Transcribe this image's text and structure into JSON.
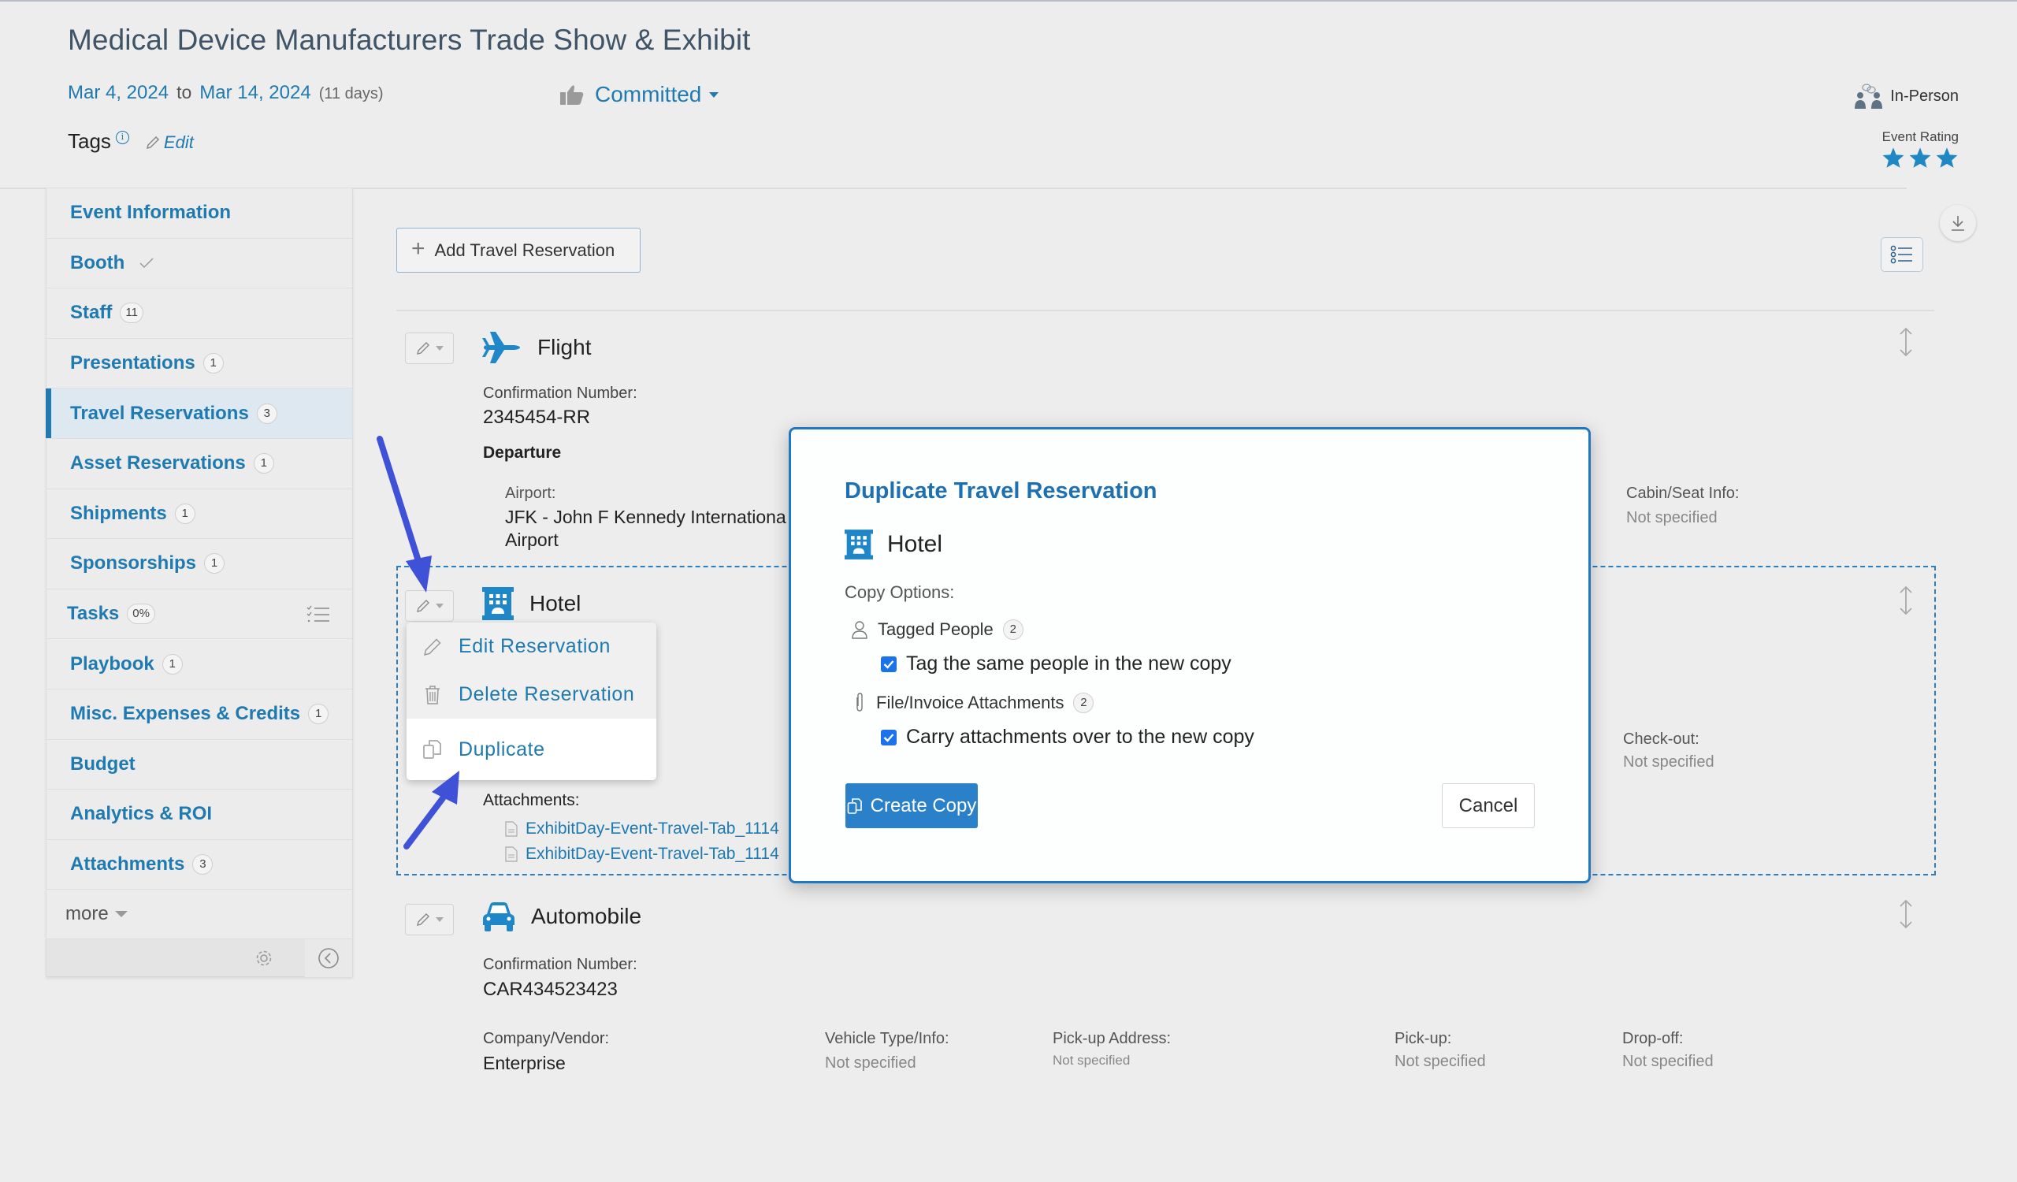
{
  "header": {
    "title": "Medical Device Manufacturers Trade Show & Exhibit",
    "start_date": "Mar 4, 2024",
    "to_label": "to",
    "end_date": "Mar 14, 2024",
    "duration": "(11 days)",
    "status": "Committed",
    "tags_label": "Tags",
    "tags_info_glyph": "i",
    "tags_edit": "Edit",
    "event_format": "In-Person",
    "rating_label": "Event Rating",
    "rating_value": 3,
    "rating_max": 3
  },
  "colors": {
    "accent": "#1e7ab0",
    "modal_border": "#2278c0",
    "primary_button": "#2a80c9",
    "annotation_arrow": "#3f51d6",
    "background": "#ededed"
  },
  "sidebar": {
    "items": [
      {
        "label": "Event Information",
        "badge": null
      },
      {
        "label": "Booth",
        "badge": null,
        "check": true
      },
      {
        "label": "Staff",
        "badge": "11"
      },
      {
        "label": "Presentations",
        "badge": "1"
      },
      {
        "label": "Travel Reservations",
        "badge": "3",
        "active": true
      },
      {
        "label": "Asset Reservations",
        "badge": "1"
      },
      {
        "label": "Shipments",
        "badge": "1"
      },
      {
        "label": "Sponsorships",
        "badge": "1"
      },
      {
        "label": "Tasks",
        "badge": "0%"
      },
      {
        "label": "Playbook",
        "badge": "1"
      },
      {
        "label": "Misc. Expenses & Credits",
        "badge": "1"
      },
      {
        "label": "Budget",
        "badge": null
      },
      {
        "label": "Analytics & ROI",
        "badge": null
      },
      {
        "label": "Attachments",
        "badge": "3"
      }
    ],
    "more_label": "more"
  },
  "main": {
    "add_button": "Add Travel Reservation",
    "flight": {
      "type": "Flight",
      "confirmation_label": "Confirmation Number:",
      "confirmation": "2345454-RR",
      "departure_label": "Departure",
      "airport_label": "Airport:",
      "airport_line1": "JFK - John F Kennedy Internationa",
      "airport_line2": "Airport",
      "cabin_label": "Cabin/Seat Info:",
      "cabin_value": "Not specified"
    },
    "hotel": {
      "type": "Hotel",
      "attachments_label": "Attachments:",
      "attachments": [
        "ExhibitDay-Event-Travel-Tab_1114",
        "ExhibitDay-Event-Travel-Tab_1114"
      ],
      "checkout_label": "Check-out:",
      "checkout_value": "Not specified"
    },
    "automobile": {
      "type": "Automobile",
      "confirmation_label": "Confirmation Number:",
      "confirmation": "CAR434523423",
      "company_label": "Company/Vendor:",
      "company": "Enterprise",
      "vehicle_label": "Vehicle Type/Info:",
      "vehicle": "Not specified",
      "pickup_address_label": "Pick-up Address:",
      "pickup_address": "Not specified",
      "pickup_label": "Pick-up:",
      "pickup": "Not specified",
      "dropoff_label": "Drop-off:",
      "dropoff": "Not specified"
    }
  },
  "dropdown_menu": {
    "items": [
      "Edit Reservation",
      "Delete Reservation",
      "Duplicate"
    ],
    "highlighted": "Duplicate"
  },
  "modal": {
    "title": "Duplicate Travel Reservation",
    "reservation_type": "Hotel",
    "copy_options_label": "Copy Options:",
    "tagged_people_label": "Tagged People",
    "tagged_people_count": "2",
    "tag_checkbox_label": "Tag the same people in the new copy",
    "tag_checked": true,
    "attachments_label": "File/Invoice Attachments",
    "attachments_count": "2",
    "attach_checkbox_label": "Carry attachments over to the new copy",
    "attach_checked": true,
    "create_button": "Create Copy",
    "cancel_button": "Cancel"
  }
}
